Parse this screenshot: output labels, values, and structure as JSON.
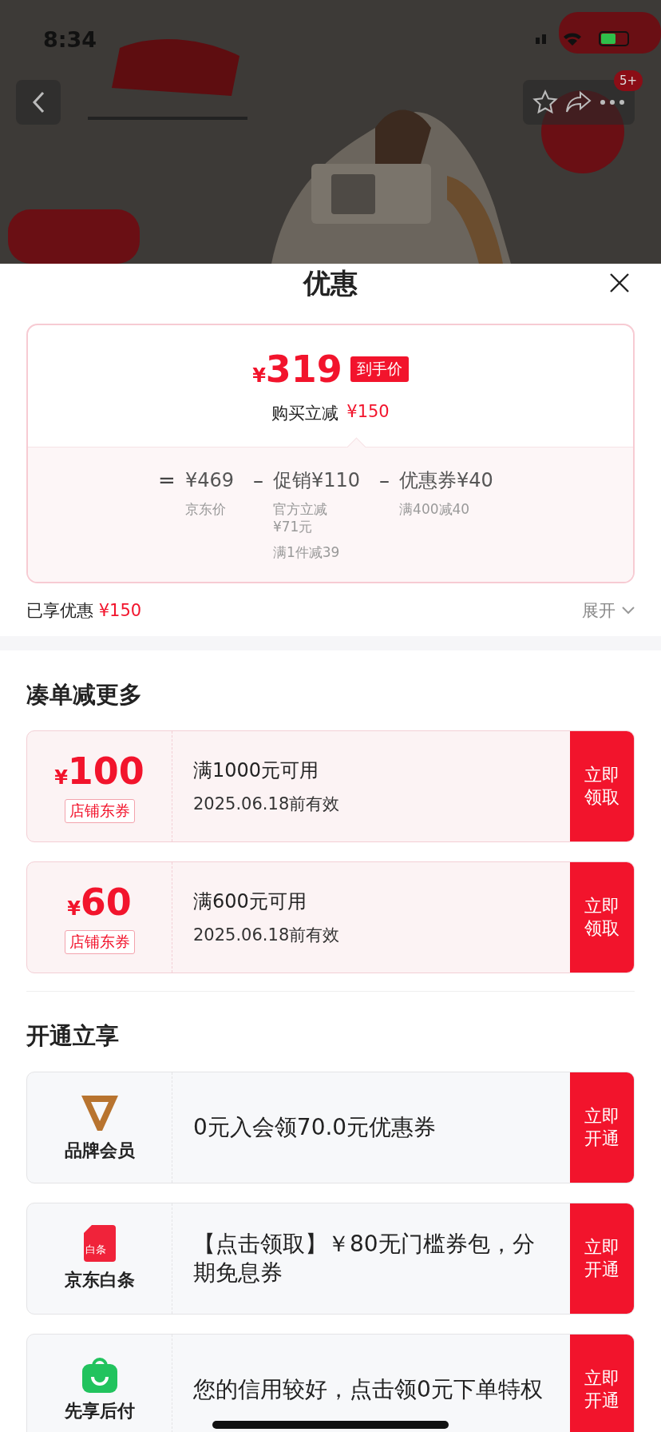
{
  "status_bar": {
    "time": "8:34"
  },
  "nav": {
    "badge": "5+"
  },
  "sheet": {
    "title": "优惠"
  },
  "price_card": {
    "currency": "¥",
    "final_price": "319",
    "price_tag": "到手价",
    "saving_label": "购买立减",
    "saving_amount": "¥150",
    "breakdown": [
      {
        "operator": "=",
        "amount": "¥469",
        "notes": [
          "京东价"
        ]
      },
      {
        "operator": "–",
        "amount": "促销¥110",
        "notes": [
          "官方立减\n¥71元",
          "满1件减39"
        ]
      },
      {
        "operator": "–",
        "amount": "优惠券¥40",
        "notes": [
          "满400减40"
        ]
      }
    ]
  },
  "enjoyed": {
    "label": "已享优惠",
    "amount": "¥150",
    "expand": "展开"
  },
  "sections": [
    {
      "title": "凑单减更多",
      "kind": "coupon",
      "items": [
        {
          "currency": "¥",
          "amount": "100",
          "tag": "店铺东券",
          "condition": "满1000元可用",
          "validity": "2025.06.18前有效",
          "action": "立即领取"
        },
        {
          "currency": "¥",
          "amount": "60",
          "tag": "店铺东券",
          "condition": "满600元可用",
          "validity": "2025.06.18前有效",
          "action": "立即领取"
        }
      ]
    },
    {
      "title": "开通立享",
      "kind": "benefit",
      "items": [
        {
          "name": "品牌会员",
          "description": "0元入会领70.0元优惠券",
          "action": "立即开通"
        },
        {
          "icon_text": "白条",
          "name": "京东白条",
          "description": "【点击领取】￥80无门槛券包，分期免息券",
          "action": "立即开通"
        },
        {
          "name": "先享后付",
          "description": "您的信用较好，点击领0元下单特权",
          "action": "立即开通"
        }
      ]
    }
  ]
}
